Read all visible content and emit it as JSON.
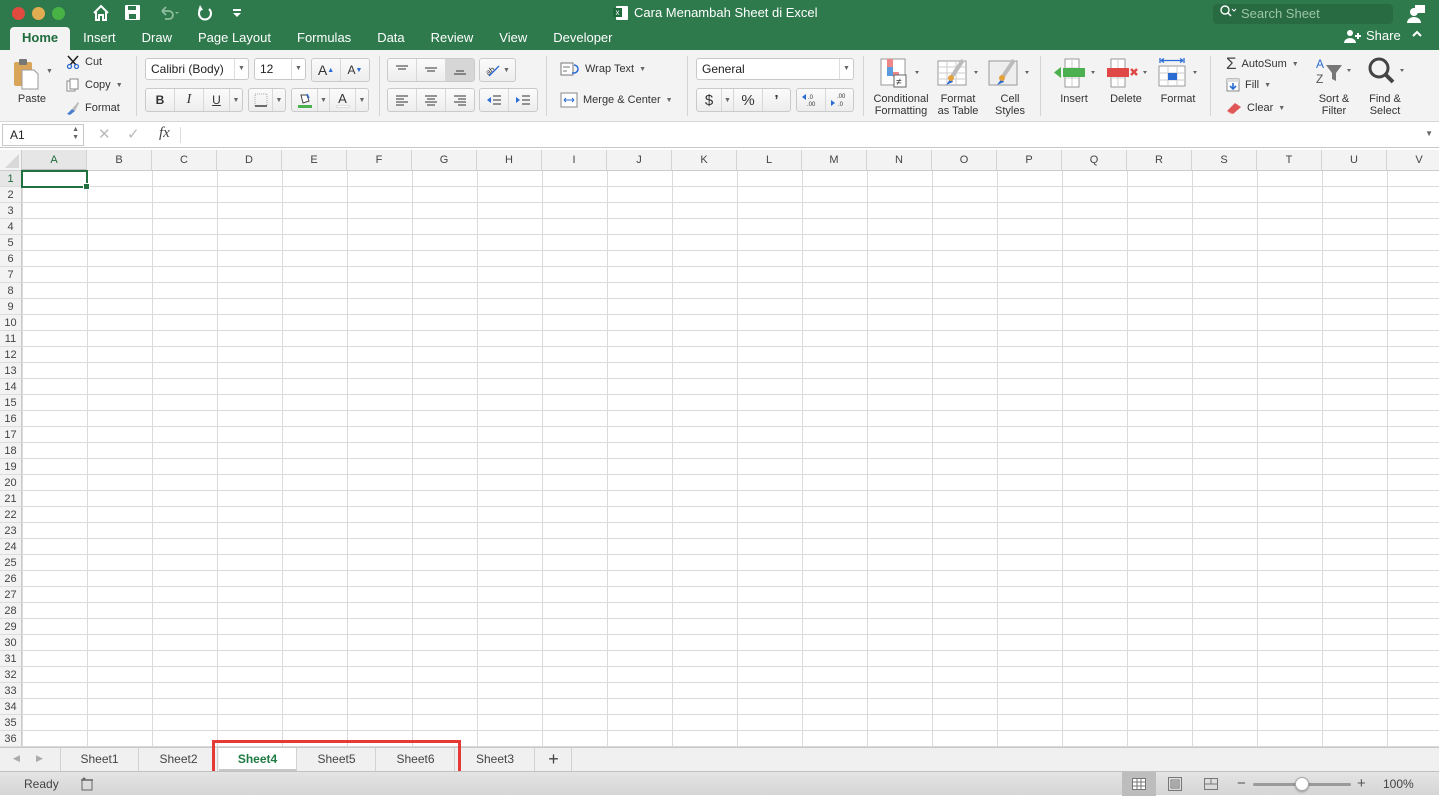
{
  "window": {
    "title": "Cara Menambah Sheet di Excel",
    "search_placeholder": "Search Sheet",
    "share_label": "Share",
    "quick_access": [
      "home-icon",
      "save-icon",
      "undo-icon",
      "redo-icon",
      "customize-icon"
    ]
  },
  "ribbon_tabs": [
    {
      "label": "Home",
      "active": true
    },
    {
      "label": "Insert"
    },
    {
      "label": "Draw"
    },
    {
      "label": "Page Layout"
    },
    {
      "label": "Formulas"
    },
    {
      "label": "Data"
    },
    {
      "label": "Review"
    },
    {
      "label": "View"
    },
    {
      "label": "Developer"
    }
  ],
  "ribbon": {
    "clipboard": {
      "paste": "Paste",
      "cut": "Cut",
      "copy": "Copy",
      "format": "Format"
    },
    "font": {
      "name": "Calibri (Body)",
      "size": "12",
      "bold": "B",
      "italic": "I",
      "underline": "U",
      "font_color_glyph": "A",
      "grow_glyph": "A",
      "shrink_glyph": "A"
    },
    "alignment": {
      "wrap_text": "Wrap Text",
      "merge_center": "Merge & Center"
    },
    "number": {
      "format": "General",
      "currency": "$",
      "percent": "%",
      "comma": "’",
      "inc_decimal": ".0 .00",
      "dec_decimal": ".00 .0"
    },
    "styles": {
      "conditional_formatting": [
        "Conditional",
        "Formatting"
      ],
      "format_as_table": [
        "Format",
        "as Table"
      ],
      "cell_styles": [
        "Cell",
        "Styles"
      ]
    },
    "cells": {
      "insert": "Insert",
      "delete": "Delete",
      "format": "Format"
    },
    "editing": {
      "autosum": "AutoSum",
      "fill": "Fill",
      "clear": "Clear",
      "sort_filter": [
        "Sort &",
        "Filter"
      ],
      "find_select": [
        "Find &",
        "Select"
      ]
    }
  },
  "formula_bar": {
    "name_box": "A1",
    "fx": "fx",
    "formula": ""
  },
  "grid": {
    "columns": [
      "A",
      "B",
      "C",
      "D",
      "E",
      "F",
      "G",
      "H",
      "I",
      "J",
      "K",
      "L",
      "M",
      "N",
      "O",
      "P",
      "Q",
      "R",
      "S",
      "T",
      "U",
      "V"
    ],
    "rows": [
      "1",
      "2",
      "3",
      "4",
      "5",
      "6",
      "7",
      "8",
      "9",
      "10",
      "11",
      "12",
      "13",
      "14",
      "15",
      "16",
      "17",
      "18",
      "19",
      "20",
      "21",
      "22",
      "23",
      "24",
      "25",
      "26",
      "27",
      "28",
      "29",
      "30",
      "31",
      "32",
      "33",
      "34",
      "35",
      "36"
    ],
    "active_cell": "A1"
  },
  "sheets": [
    {
      "label": "Sheet1"
    },
    {
      "label": "Sheet2"
    },
    {
      "label": "Sheet4",
      "active": true
    },
    {
      "label": "Sheet5"
    },
    {
      "label": "Sheet6"
    },
    {
      "label": "Sheet3"
    }
  ],
  "add_sheet": "+",
  "status": {
    "text": "Ready",
    "zoom": "100%",
    "zoom_fraction": 0.5
  },
  "colors": {
    "accent": "#2f7a4d",
    "active_text": "#1f6b3c",
    "highlight": "#e53935"
  }
}
